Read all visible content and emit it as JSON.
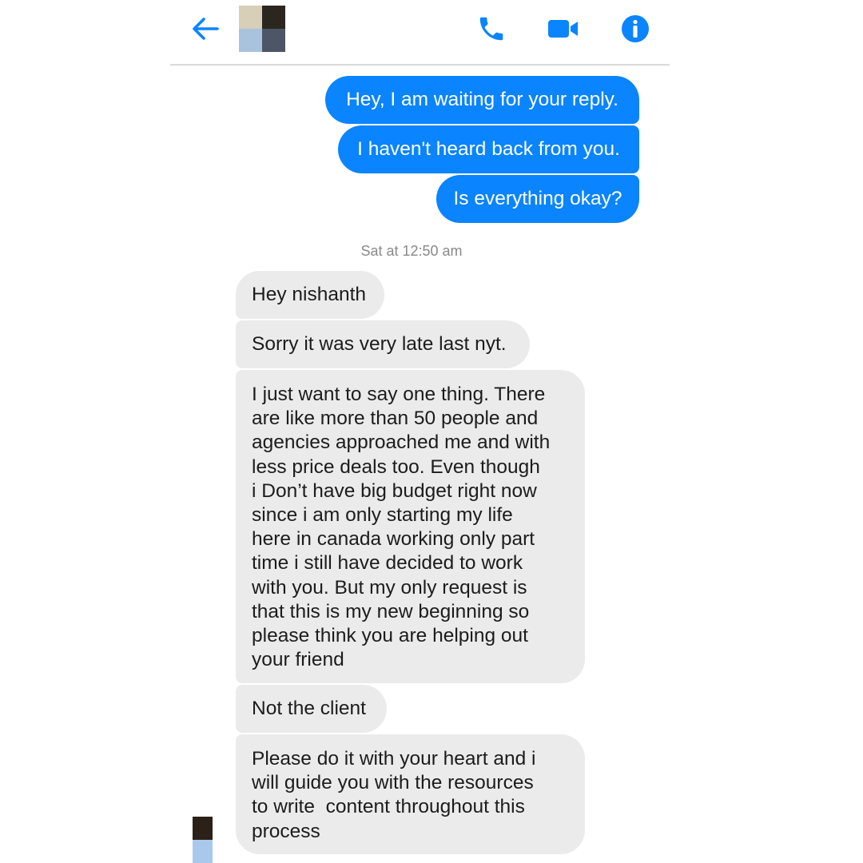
{
  "header": {
    "back_icon": "arrow-left-icon",
    "avatar_icon": "contact-avatar-pixelated",
    "phone_icon": "phone-icon",
    "video_icon": "video-camera-icon",
    "info_icon": "info-icon",
    "accent_color": "#0a84ff"
  },
  "messages": {
    "outgoing": [
      {
        "text": "Hey, I am waiting for your reply."
      },
      {
        "text": "I haven't heard back from you."
      },
      {
        "text": "Is everything okay?"
      }
    ],
    "timestamp": "Sat at 12:50 am",
    "incoming": [
      {
        "text": "Hey nishanth"
      },
      {
        "text": "Sorry it was very late last nyt."
      },
      {
        "text": "I just want to say one thing. There\nare like more than 50 people and\nagencies approached me and with\nless price deals too. Even though\ni Don’t have big budget right now\nsince i am only starting my life\nhere in canada working only part\ntime i still have decided to work\nwith you. But my only request is\nthat this is my new beginning so\nplease think you are helping out\nyour friend"
      },
      {
        "text": "Not the client"
      },
      {
        "text": "Please do it with your heart and i\nwill guide you with the resources\nto write  content throughout this\nprocess"
      }
    ]
  },
  "colors": {
    "outgoing_bubble": "#0a84ff",
    "incoming_bubble": "#ebebeb",
    "timestamp_text": "#8a8a8a"
  }
}
